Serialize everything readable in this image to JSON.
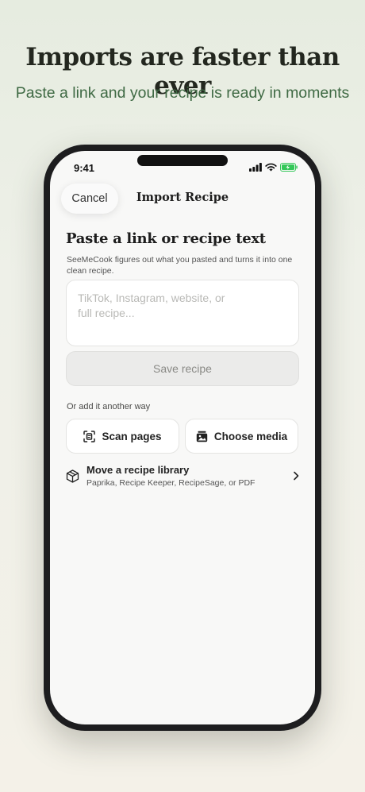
{
  "promo": {
    "headline": "Imports are faster than ever",
    "subhead": "Paste a link and your recipe is ready in moments"
  },
  "status_bar": {
    "time": "9:41",
    "icons": [
      "signal-icon",
      "wifi-icon",
      "battery-charging-icon"
    ]
  },
  "nav": {
    "cancel_label": "Cancel",
    "title": "Import Recipe"
  },
  "paste_section": {
    "title": "Paste a link or recipe text",
    "description": "SeeMeCook figures out what you pasted and turns it into one clean recipe.",
    "input_value": "",
    "input_placeholder": "TikTok, Instagram, website, or\nfull recipe...",
    "save_label": "Save recipe"
  },
  "alternatives": {
    "label": "Or add it another way",
    "scan_label": "Scan pages",
    "scan_icon": "scan-icon",
    "media_label": "Choose media",
    "media_icon": "photo-library-icon"
  },
  "library": {
    "title": "Move a recipe library",
    "subtitle": "Paprika, Recipe Keeper, RecipeSage, or PDF",
    "icon": "package-icon",
    "chevron": "chevron-right-icon"
  },
  "colors": {
    "headline": "#23271f",
    "subhead": "#3f6a44",
    "battery": "#34c759"
  }
}
